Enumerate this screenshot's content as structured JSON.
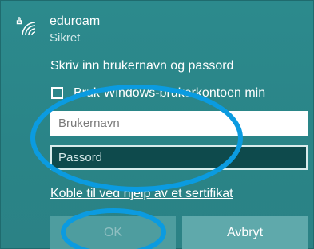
{
  "network": {
    "name": "eduroam",
    "status": "Sikret",
    "icon": "wifi-secured-icon"
  },
  "prompt": "Skriv inn brukernavn og passord",
  "checkbox": {
    "label": "Bruk Windows-brukerkontoen min",
    "checked": false
  },
  "username": {
    "placeholder": "Brukernavn",
    "value": ""
  },
  "password": {
    "placeholder": "Passord",
    "value": ""
  },
  "cert_link": "Koble til ved hjelp av et sertifikat",
  "buttons": {
    "ok_label": "OK",
    "ok_enabled": false,
    "cancel_label": "Avbryt"
  },
  "colors": {
    "background": "#2a8286",
    "annotation": "#0b9be0",
    "password_field": "#0e4a4c"
  }
}
